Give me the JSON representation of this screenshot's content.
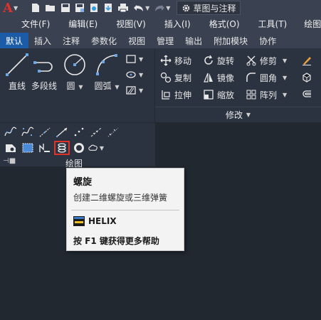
{
  "qat": {
    "logo_letter": "A",
    "workspace_label": "草图与注释"
  },
  "menubar": {
    "items": [
      "文件(F)",
      "编辑(E)",
      "视图(V)",
      "插入(I)",
      "格式(O)",
      "工具(T)",
      "绘图(D"
    ]
  },
  "ribbon": {
    "tabs": [
      "默认",
      "插入",
      "注释",
      "参数化",
      "视图",
      "管理",
      "输出",
      "附加模块",
      "协作"
    ],
    "active_tab": "默认",
    "draw": {
      "title": "绘图",
      "big_buttons": [
        "直线",
        "多段线",
        "圆",
        "圆弧"
      ]
    },
    "modify": {
      "title": "修改",
      "col1": [
        "移动",
        "复制",
        "拉伸"
      ],
      "col2": [
        "旋转",
        "镜像",
        "缩放"
      ],
      "col3": [
        "修剪",
        "圆角",
        "阵列"
      ]
    }
  },
  "tooltip": {
    "title": "螺旋",
    "description": "创建二维螺旋或三维弹簧",
    "command": "HELIX",
    "help": "按 F1 键获得更多帮助"
  },
  "colors": {
    "accent": "#1c5ba8",
    "highlight_red": "#e0322b",
    "toolbar_bg": "#3a4150",
    "canvas_bg": "#212830"
  }
}
